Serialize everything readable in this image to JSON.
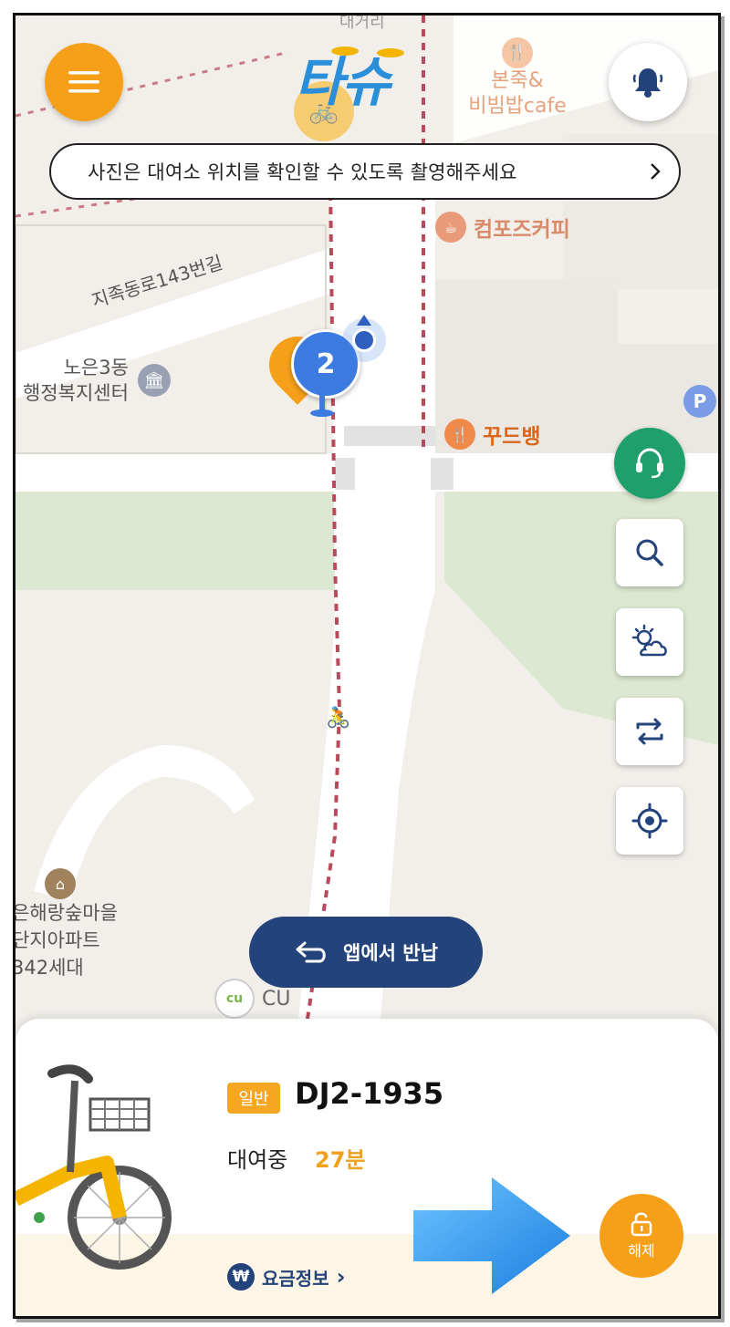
{
  "app": {
    "logo_text": "타슈"
  },
  "notice": {
    "text": "사진은 대여소 위치를 확인할 수 있도록 촬영해주세요"
  },
  "map": {
    "roads": [
      "지족동로143번길"
    ],
    "pois": [
      {
        "name": "본죽&\n비빔밥cafe",
        "type": "restaurant"
      },
      {
        "name": "컴포즈커피",
        "type": "cafe"
      },
      {
        "name": "꾸드뱅",
        "type": "restaurant"
      },
      {
        "name": "노은3동\n행정복지센터",
        "type": "government"
      },
      {
        "name": "은해랑숲마을\n단지아파트\n342세대",
        "type": "apartment"
      },
      {
        "name": "CU",
        "type": "convenience-store"
      }
    ],
    "top_partial_label": "대거리",
    "cluster_count": "2",
    "parking_label": "P",
    "colors": {
      "route": "#b94a5c",
      "park": "#dfe9d3",
      "road": "#ffffff",
      "ground": "#f2efeb"
    }
  },
  "buttons": {
    "return_label": "앱에서 반납",
    "unlock_label": "해제"
  },
  "rental": {
    "badge": "일반",
    "bike_id": "DJ2-1935",
    "status_label": "대여중",
    "elapsed": "27분",
    "fare_label": "요금정보",
    "fare_chevron": "›",
    "won_symbol": "₩"
  },
  "colors": {
    "accent": "#f6a01a",
    "navy": "#23437a",
    "green": "#1e9f6b"
  }
}
